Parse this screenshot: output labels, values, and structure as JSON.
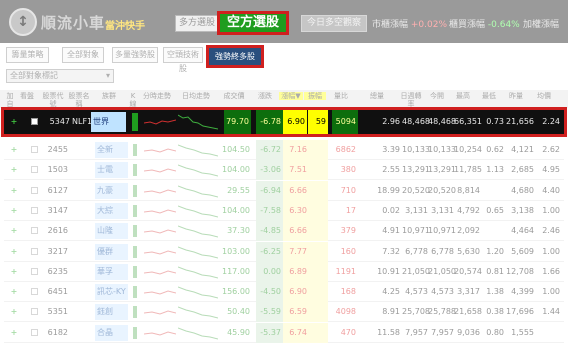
{
  "header": {
    "logo_text": "順流小車",
    "logo_sub": "當沖快手",
    "bull_tab": "多方選股",
    "bear_tab": "空方選股",
    "today_tab": "今日多空觀察",
    "market_change_label": "市櫃漲幅",
    "market_change_value": "+0.02%",
    "otc_change_label": "櫃買漲幅",
    "otc_change_value": "-0.64%",
    "weighted_label": "加權漲幅"
  },
  "toolbar": {
    "tabs": [
      "籌量策略",
      "全部對象",
      "多量強勢股",
      "空頭技術股"
    ],
    "strong_tab": "強勢終多股",
    "filter_select": "全部對象標記"
  },
  "columns": [
    "加自選",
    "看盤",
    "股票代號",
    "股票名稱",
    "族群",
    "K線",
    "分時走勢",
    "日均走勢",
    "成交價",
    "漲跌",
    "漲幅▼",
    "振幅",
    "量比",
    "總量",
    "日週轉率",
    "今開",
    "最高",
    "最低",
    "昨量",
    "均價",
    "內外盤",
    "內盤",
    "外盤"
  ],
  "highlighted_row": {
    "code": "5347",
    "name": "NLF1",
    "group": "世界",
    "price": "79.70",
    "change": "-6.78",
    "pct": "6.90",
    "amp": "59",
    "volume": "5094",
    "turnover": "2.96",
    "open": "48,468",
    "high": "48,468",
    "low": "66,351",
    "ratio": "0.73",
    "inner": "21,656",
    "outer": "2.24"
  },
  "rows": [
    {
      "code": "2455",
      "name": "全新",
      "price": "104.50",
      "change": "-6.72",
      "pct": "7.16",
      "amp": "52",
      "volume": "6862",
      "turnover": "3.39",
      "open": "10,133",
      "high": "10,133",
      "low": "10,254",
      "ratio": "0.62",
      "inner": "4,121",
      "outer": "2.62"
    },
    {
      "code": "1503",
      "name": "士電",
      "price": "104.00",
      "change": "-3.06",
      "pct": "7.51",
      "amp": "",
      "volume": "380",
      "turnover": "2.55",
      "open": "13,291",
      "high": "13,291",
      "low": "11,785",
      "ratio": "1.13",
      "inner": "2,685",
      "outer": "4.95"
    },
    {
      "code": "6127",
      "name": "九豪",
      "price": "29.55",
      "change": "-6.94",
      "pct": "6.66",
      "amp": "",
      "volume": "710",
      "turnover": "18.99",
      "open": "20,520",
      "high": "20,520",
      "low": "8,814",
      "ratio": "",
      "inner": "4,680",
      "outer": "4.40"
    },
    {
      "code": "3147",
      "name": "大綜",
      "price": "104.00",
      "change": "-7.58",
      "pct": "6.30",
      "amp": "",
      "volume": "17",
      "turnover": "0.02",
      "open": "3,131",
      "high": "3,131",
      "low": "4,792",
      "ratio": "0.65",
      "inner": "3,138",
      "outer": "1.00"
    },
    {
      "code": "2616",
      "name": "山隆",
      "price": "37.30",
      "change": "-4.85",
      "pct": "6.66",
      "amp": "",
      "volume": "379",
      "turnover": "4.91",
      "open": "10,971",
      "high": "10,971",
      "low": "2,092",
      "ratio": "",
      "inner": "4,464",
      "outer": "2.46"
    },
    {
      "code": "3217",
      "name": "優群",
      "price": "103.00",
      "change": "-6.25",
      "pct": "7.77",
      "amp": "",
      "volume": "160",
      "turnover": "7.32",
      "open": "6,778",
      "high": "6,778",
      "low": "5,630",
      "ratio": "1.20",
      "inner": "5,609",
      "outer": "1.00"
    },
    {
      "code": "6235",
      "name": "華孚",
      "price": "117.00",
      "change": "0.00",
      "pct": "6.89",
      "amp": "",
      "volume": "1191",
      "turnover": "10.91",
      "open": "21,050",
      "high": "21,050",
      "low": "20,574",
      "ratio": "0.81",
      "inner": "12,708",
      "outer": "1.66"
    },
    {
      "code": "6451",
      "name": "訊芯-KY",
      "price": "156.00",
      "change": "-4.50",
      "pct": "6.90",
      "amp": "",
      "volume": "168",
      "turnover": "4.25",
      "open": "4,573",
      "high": "4,573",
      "low": "3,317",
      "ratio": "1.38",
      "inner": "4,399",
      "outer": "1.00"
    },
    {
      "code": "5351",
      "name": "鈺創",
      "price": "50.40",
      "change": "-5.59",
      "pct": "6.59",
      "amp": "",
      "volume": "4098",
      "turnover": "8.91",
      "open": "25,708",
      "high": "25,788",
      "low": "21,658",
      "ratio": "0.38",
      "inner": "17,696",
      "outer": "1.44"
    },
    {
      "code": "6182",
      "name": "合晶",
      "price": "45.90",
      "change": "-5.37",
      "pct": "6.74",
      "amp": "",
      "volume": "470",
      "turnover": "11.58",
      "open": "7,957",
      "high": "7,957",
      "low": "9,036",
      "ratio": "0.80",
      "inner": "1,555",
      "outer": ""
    }
  ]
}
